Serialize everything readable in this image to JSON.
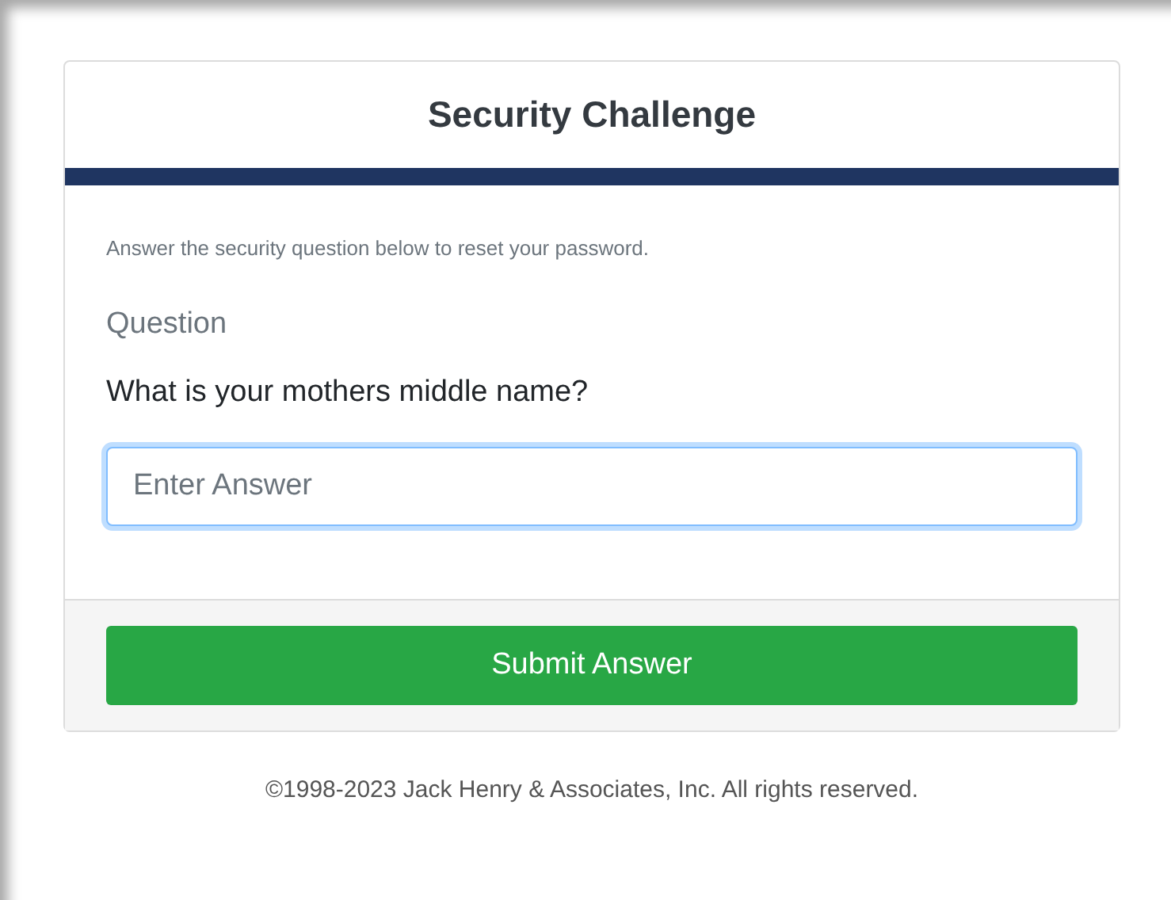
{
  "card": {
    "title": "Security Challenge",
    "instructions": "Answer the security question below to reset your password.",
    "question_label": "Question",
    "question": "What is your mothers middle name?",
    "answer": {
      "placeholder": "Enter Answer",
      "focused": true
    },
    "submit_button": "Submit Answer"
  },
  "footer": {
    "copyright": "©1998-2023 Jack Henry & Associates, Inc. All rights reserved."
  }
}
